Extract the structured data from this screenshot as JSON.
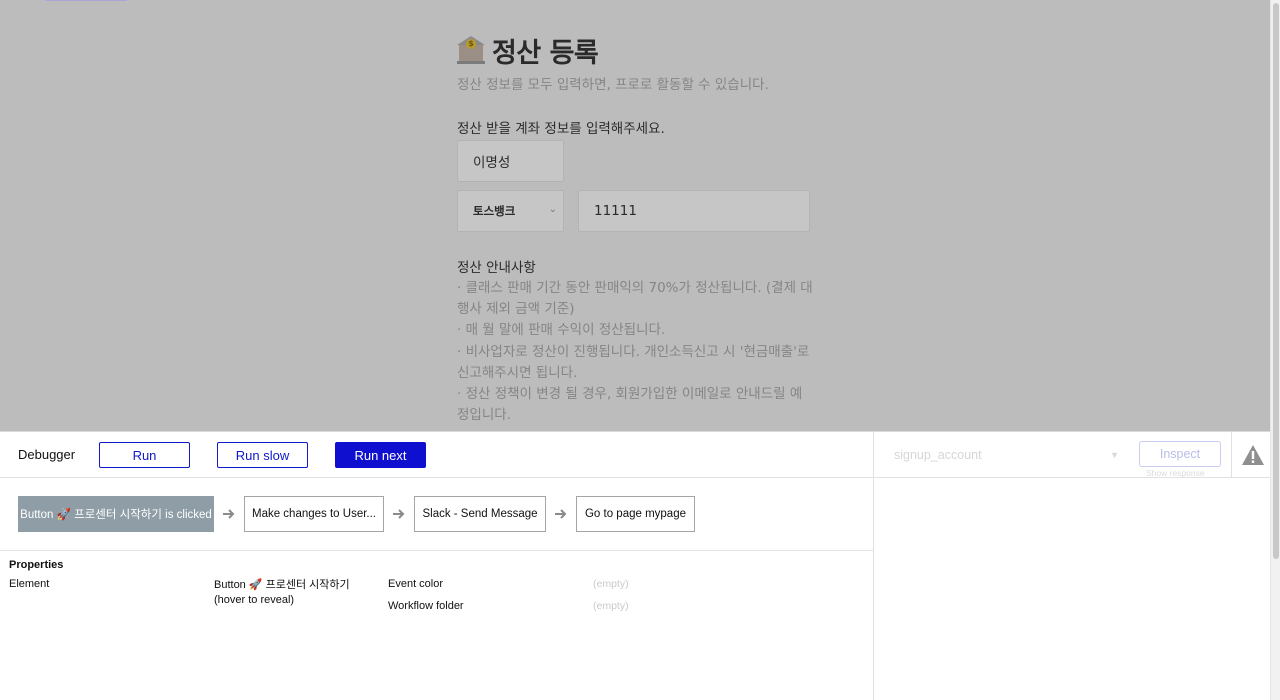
{
  "page": {
    "title": "정산 등록",
    "subtitle": "정산 정보를 모두 입력하면, 프로로 활동할 수 있습니다.",
    "account_prompt": "정산 받을 계좌 정보를 입력해주세요.",
    "holder_name": "이명성",
    "bank": "토스뱅크",
    "account_number": "11111",
    "notice_heading": "정산 안내사항",
    "notices": [
      "· 클래스 판매 기간 동안 판매익의 70%가 정산됩니다. (결제 대행사 제외 금액 기준)",
      "· 매 월 말에 판매 수익이 정산됩니다.",
      "· 비사업자로 정산이 진행됩니다. 개인소득신고 시 '현금매출'로 신고해주시면 됩니다.",
      "· 정산 정책이 변경 될 경우, 회원가입한 이메일로 안내드릴 예정입니다."
    ]
  },
  "debugger": {
    "label": "Debugger",
    "run_label": "Run",
    "run_slow_label": "Run slow",
    "run_next_label": "Run next",
    "element_select_value": "signup_account",
    "inspect_label": "Inspect",
    "show_response_label": "Show response",
    "warning_icon": "warning-triangle-icon",
    "steps": [
      "Button 🚀 프로센터 시작하기 is clicked",
      "Make changes to User...",
      "Slack - Send Message",
      "Go to page mypage"
    ],
    "properties": {
      "title": "Properties",
      "element_label": "Element",
      "element_value": "Button 🚀 프로센터 시작하기 (hover to reveal)",
      "event_color_label": "Event color",
      "event_color_value": "(empty)",
      "workflow_folder_label": "Workflow folder",
      "workflow_folder_value": "(empty)"
    }
  },
  "colors": {
    "primary_button": "#0f0fcf",
    "active_step": "#8f9da6",
    "overlay": "#bcbcbc"
  }
}
